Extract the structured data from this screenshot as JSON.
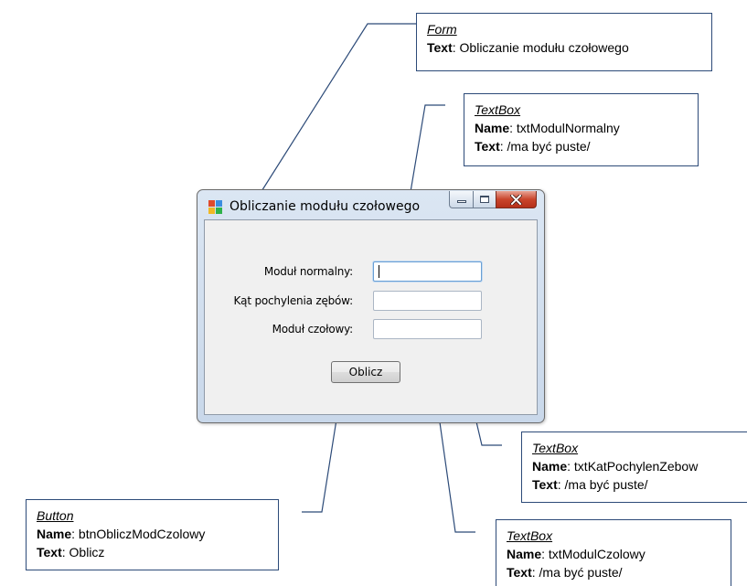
{
  "form": {
    "title": "Obliczanie modułu czołowego",
    "labels": {
      "modul_normalny": "Moduł normalny:",
      "kat_pochylenia": "Kąt pochylenia zębów:",
      "modul_czolowy": "Moduł czołowy:"
    },
    "inputs": {
      "modul_normalny": "",
      "kat_pochylenia": "",
      "modul_czolowy": ""
    },
    "button_label": "Oblicz"
  },
  "callouts": {
    "form": {
      "type": "Form",
      "text_key": "Text",
      "text_value": ": Obliczanie modułu czołowego"
    },
    "txt_modul_normalny": {
      "type": "TextBox",
      "name_key": "Name",
      "name_value": ": txtModulNormalny",
      "text_key": "Text",
      "text_value": ": /ma być puste/"
    },
    "txt_kat_pochylenia": {
      "type": "TextBox",
      "name_key": "Name",
      "name_value": ": txtKatPochylenZebow",
      "text_key": "Text",
      "text_value": ": /ma być puste/"
    },
    "txt_modul_czolowy": {
      "type": "TextBox",
      "name_key": "Name",
      "name_value": ": txtModulCzolowy",
      "text_key": "Text",
      "text_value": ": /ma być puste/"
    },
    "btn_oblicz": {
      "type": "Button",
      "name_key": "Name",
      "name_value": ": btnObliczModCzolowy",
      "text_key": "Text",
      "text_value": ": Oblicz"
    }
  },
  "colors": {
    "callout_border": "#2c4a78",
    "leader_line": "#2c4a78",
    "close_button": "#c9452c"
  }
}
